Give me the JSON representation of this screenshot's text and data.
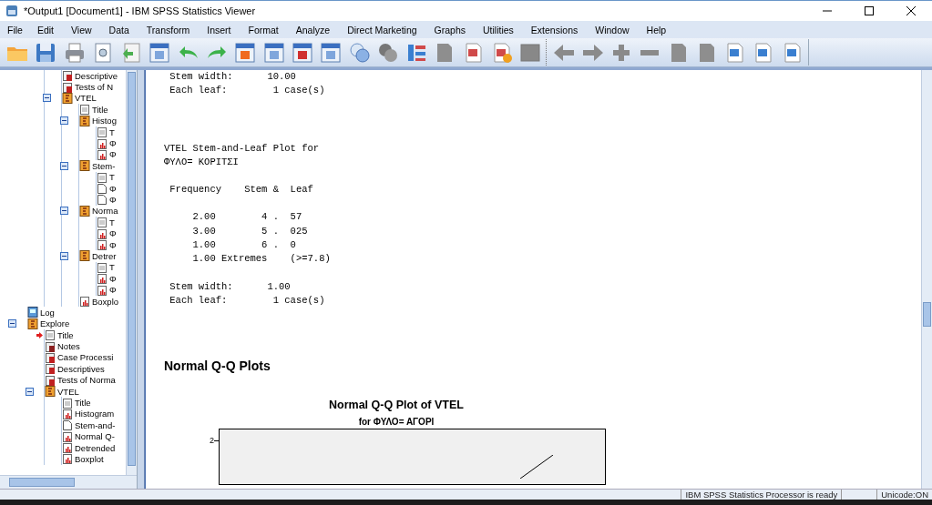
{
  "window": {
    "title": "*Output1 [Document1] - IBM SPSS Statistics Viewer"
  },
  "menu": [
    "File",
    "Edit",
    "View",
    "Data",
    "Transform",
    "Insert",
    "Format",
    "Analyze",
    "Direct Marketing",
    "Graphs",
    "Utilities",
    "Extensions",
    "Window",
    "Help"
  ],
  "outline": [
    {
      "children": [
        {
          "children": [
            {
              "label": "Descriptive",
              "kind": "table"
            },
            {
              "label": "Tests of N",
              "kind": "table"
            },
            {
              "label": "VTEL",
              "kind": "folder",
              "expanded": true,
              "children": [
                {
                  "label": "Title",
                  "kind": "title"
                },
                {
                  "label": "Histog",
                  "kind": "folder",
                  "expanded": true,
                  "children": [
                    {
                      "label": "T",
                      "kind": "title"
                    },
                    {
                      "label": "Φ",
                      "kind": "chart"
                    },
                    {
                      "label": "Φ",
                      "kind": "chart"
                    }
                  ]
                },
                {
                  "label": "Stem-",
                  "kind": "folder",
                  "expanded": true,
                  "children": [
                    {
                      "label": "T",
                      "kind": "title"
                    },
                    {
                      "label": "Φ",
                      "kind": "text"
                    },
                    {
                      "label": "Φ",
                      "kind": "text"
                    }
                  ]
                },
                {
                  "label": "Norma",
                  "kind": "folder",
                  "expanded": true,
                  "children": [
                    {
                      "label": "T",
                      "kind": "title"
                    },
                    {
                      "label": "Φ",
                      "kind": "chart"
                    },
                    {
                      "label": "Φ",
                      "kind": "chart"
                    }
                  ]
                },
                {
                  "label": "Detrer",
                  "kind": "folder",
                  "expanded": true,
                  "children": [
                    {
                      "label": "T",
                      "kind": "title"
                    },
                    {
                      "label": "Φ",
                      "kind": "chart"
                    },
                    {
                      "label": "Φ",
                      "kind": "chart"
                    }
                  ]
                },
                {
                  "label": "Boxplo",
                  "kind": "chart"
                }
              ]
            }
          ]
        }
      ]
    },
    {
      "label": "Log",
      "kind": "log"
    },
    {
      "label": "Explore",
      "kind": "folder",
      "expanded": true,
      "children": [
        {
          "label": "Title",
          "kind": "title",
          "current": true
        },
        {
          "label": "Notes",
          "kind": "notes"
        },
        {
          "label": "Case Processi",
          "kind": "table"
        },
        {
          "label": "Descriptives",
          "kind": "table"
        },
        {
          "label": "Tests of Norma",
          "kind": "table"
        },
        {
          "label": "VTEL",
          "kind": "folder",
          "expanded": true,
          "children": [
            {
              "label": "Title",
              "kind": "title"
            },
            {
              "label": "Histogram",
              "kind": "chart"
            },
            {
              "label": "Stem-and-",
              "kind": "text"
            },
            {
              "label": "Normal Q-",
              "kind": "chart"
            },
            {
              "label": "Detrended",
              "kind": "chart"
            },
            {
              "label": "Boxplot",
              "kind": "chart"
            }
          ]
        }
      ]
    }
  ],
  "stem_leaf_plots": [
    {
      "footer": [
        " Stem width:      10.00",
        " Each leaf:        1 case(s)"
      ]
    },
    {
      "title": [
        "VTEL Stem-and-Leaf Plot for",
        "ΦΥΛΟ= ΚΟΡΙΤΣΙ"
      ],
      "header": " Frequency    Stem &  Leaf",
      "rows": [
        "     2.00        4 .  57",
        "     3.00        5 .  025",
        "     1.00        6 .  0",
        "     1.00 Extremes    (>=7.8)"
      ],
      "footer": [
        " Stem width:      1.00",
        " Each leaf:        1 case(s)"
      ]
    }
  ],
  "qq_section": {
    "heading": "Normal Q-Q Plots",
    "chart_title": "Normal Q-Q Plot of VTEL",
    "chart_subtitle": "for ΦΥΛΟ= ΑΓΟΡΙ",
    "y_tick": "2"
  },
  "status_bar": {
    "message": "IBM SPSS Statistics Processor is ready",
    "encoding": "Unicode:ON"
  }
}
